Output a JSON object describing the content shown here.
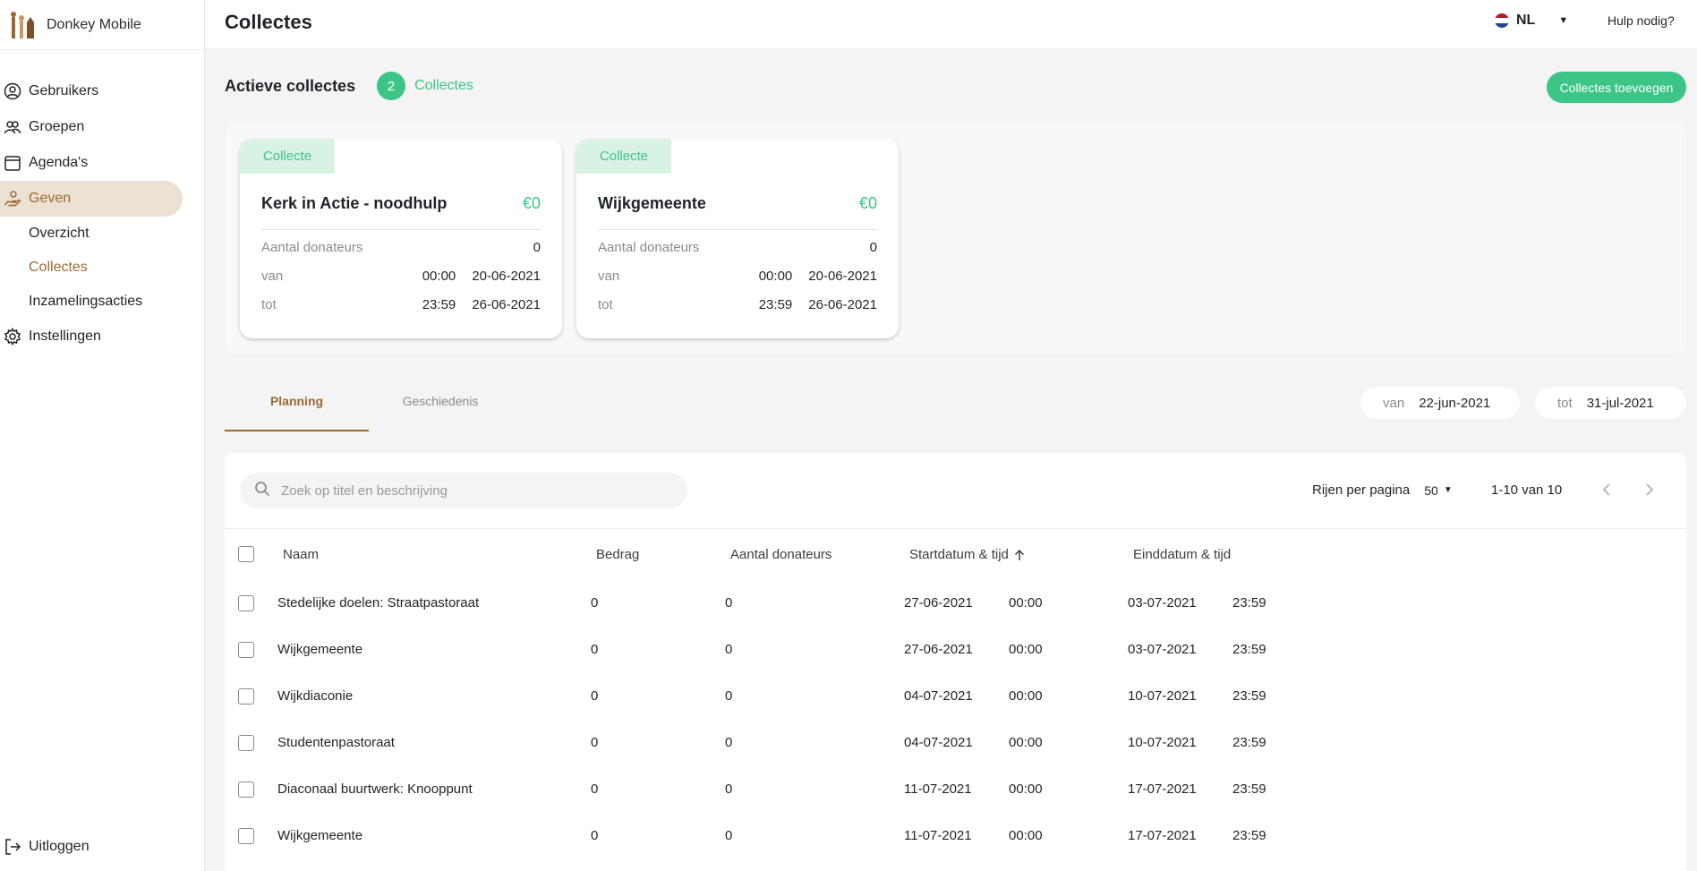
{
  "brand": {
    "name": "Donkey Mobile"
  },
  "header": {
    "title": "Collectes",
    "language": "NL",
    "help": "Hulp nodig?"
  },
  "sidebar": {
    "items": [
      {
        "label": "Gebruikers",
        "icon": "user-circle-icon"
      },
      {
        "label": "Groepen",
        "icon": "group-icon"
      },
      {
        "label": "Agenda's",
        "icon": "calendar-icon"
      },
      {
        "label": "Geven",
        "icon": "hand-coin-icon"
      }
    ],
    "subitems": [
      {
        "label": "Overzicht"
      },
      {
        "label": "Collectes"
      },
      {
        "label": "Inzamelingsacties"
      }
    ],
    "settings": "Instellingen",
    "logout": "Uitloggen"
  },
  "active": {
    "title": "Actieve collectes",
    "count": "2",
    "count_label": "Collectes",
    "add_button": "Collectes toevoegen",
    "cards": [
      {
        "tag": "Collecte",
        "title": "Kerk in Actie - noodhulp",
        "amount": "€0",
        "donors_label": "Aantal donateurs",
        "donors": "0",
        "from_label": "van",
        "from_time": "00:00",
        "from_date": "20-06-2021",
        "to_label": "tot",
        "to_time": "23:59",
        "to_date": "26-06-2021"
      },
      {
        "tag": "Collecte",
        "title": "Wijkgemeente",
        "amount": "€0",
        "donors_label": "Aantal donateurs",
        "donors": "0",
        "from_label": "van",
        "from_time": "00:00",
        "from_date": "20-06-2021",
        "to_label": "tot",
        "to_time": "23:59",
        "to_date": "26-06-2021"
      }
    ]
  },
  "tabs": {
    "planning": "Planning",
    "history": "Geschiedenis"
  },
  "filters": {
    "from_label": "van",
    "from_value": "22-jun-2021",
    "to_label": "tot",
    "to_value": "31-jul-2021"
  },
  "table": {
    "search_placeholder": "Zoek op titel en beschrijving",
    "rows_per_page_label": "Rijen per pagina",
    "rows_per_page_value": "50",
    "range": "1-10 van 10",
    "columns": {
      "name": "Naam",
      "amount": "Bedrag",
      "donors": "Aantal donateurs",
      "start": "Startdatum & tijd",
      "end": "Einddatum & tijd"
    },
    "rows": [
      {
        "name": "Stedelijke doelen: Straatpastoraat",
        "amount": "0",
        "donors": "0",
        "start_date": "27-06-2021",
        "start_time": "00:00",
        "end_date": "03-07-2021",
        "end_time": "23:59"
      },
      {
        "name": "Wijkgemeente",
        "amount": "0",
        "donors": "0",
        "start_date": "27-06-2021",
        "start_time": "00:00",
        "end_date": "03-07-2021",
        "end_time": "23:59"
      },
      {
        "name": "Wijkdiaconie",
        "amount": "0",
        "donors": "0",
        "start_date": "04-07-2021",
        "start_time": "00:00",
        "end_date": "10-07-2021",
        "end_time": "23:59"
      },
      {
        "name": "Studentenpastoraat",
        "amount": "0",
        "donors": "0",
        "start_date": "04-07-2021",
        "start_time": "00:00",
        "end_date": "10-07-2021",
        "end_time": "23:59"
      },
      {
        "name": "Diaconaal buurtwerk: Knooppunt",
        "amount": "0",
        "donors": "0",
        "start_date": "11-07-2021",
        "start_time": "00:00",
        "end_date": "17-07-2021",
        "end_time": "23:59"
      },
      {
        "name": "Wijkgemeente",
        "amount": "0",
        "donors": "0",
        "start_date": "11-07-2021",
        "start_time": "00:00",
        "end_date": "17-07-2021",
        "end_time": "23:59"
      }
    ]
  },
  "colors": {
    "accent": "#3cc587",
    "brand": "#9b6a34",
    "active_nav_bg": "#ece1d3"
  }
}
